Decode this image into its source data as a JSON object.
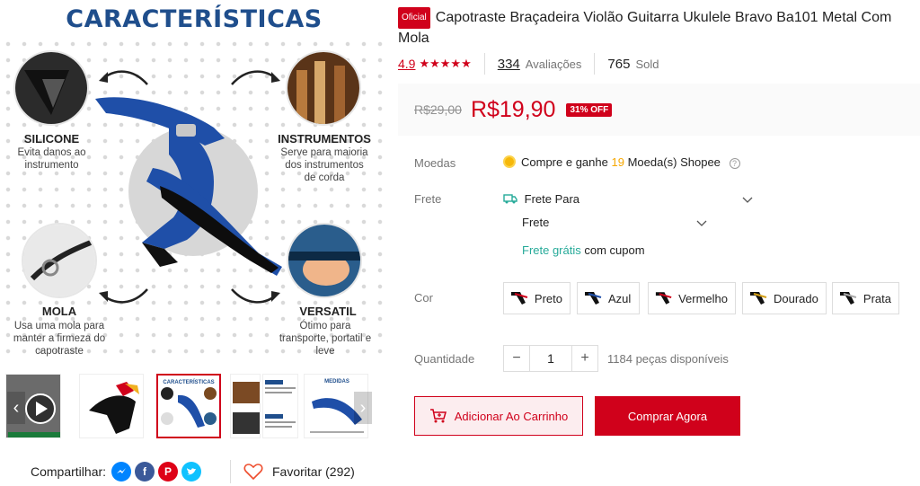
{
  "gallery": {
    "banner_title": "CARACTERÍSTICAS",
    "features": [
      {
        "title": "SILICONE",
        "desc_line1": "Evita danos ao",
        "desc_line2": "instrumento",
        "desc_line3": ""
      },
      {
        "title": "INSTRUMENTOS",
        "desc_line1": "Serve para maioria",
        "desc_line2": "dos instrumentos",
        "desc_line3": "de corda"
      },
      {
        "title": "MOLA",
        "desc_line1": "Usa uma mola para",
        "desc_line2": "manter a firmeza do",
        "desc_line3": "capotraste"
      },
      {
        "title": "VERSATIL",
        "desc_line1": "Ótimo para",
        "desc_line2": "transporte, portatil e",
        "desc_line3": "leve"
      }
    ],
    "thumb_feature_title": "CARACTERÍSTICAS",
    "thumb_measure_title": "MEDIDAS"
  },
  "share": {
    "label": "Compartilhar:"
  },
  "favorite": {
    "label": "Favoritar (292)"
  },
  "product": {
    "badge": "Oficial",
    "title": "Capotraste Braçadeira Violão Guitarra Ukulele Bravo Ba101 Metal Com Mola",
    "rating": "4.9",
    "stars": "★★★★★",
    "reviews_count": "334",
    "reviews_label": "Avaliações",
    "sold_count": "765",
    "sold_label": "Sold",
    "old_price": "R$29,00",
    "price": "R$19,90",
    "discount": "31% OFF"
  },
  "coins": {
    "label": "Moedas",
    "text_before": "Compre e ganhe",
    "amount": "19",
    "text_after": "Moeda(s) Shopee",
    "help": "?"
  },
  "shipping": {
    "label": "Frete",
    "to_label": "Frete Para",
    "fee_label": "Frete",
    "free_highlight": "Frete grátis",
    "free_rest": "com cupom"
  },
  "colors": {
    "label": "Cor",
    "options": [
      "Preto",
      "Azul",
      "Vermelho",
      "Dourado",
      "Prata"
    ]
  },
  "quantity": {
    "label": "Quantidade",
    "minus": "−",
    "value": "1",
    "plus": "+",
    "available": "1184 peças disponíveis"
  },
  "actions": {
    "add_to_cart": "Adicionar Ao Carrinho",
    "buy_now": "Comprar Agora"
  },
  "theme": {
    "accent": "#d0011b",
    "coin": "#f6b80a",
    "free_shipping": "#26aa99",
    "banner_blue": "#1f4e8c",
    "capo_blue": "#1f4fa8"
  }
}
